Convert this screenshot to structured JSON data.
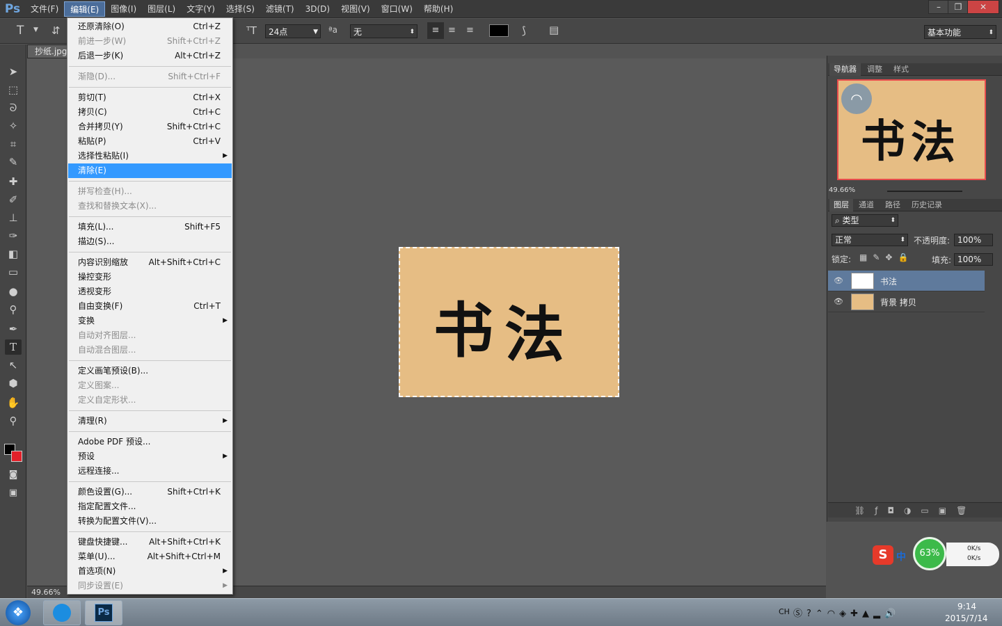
{
  "app": {
    "logo": "Ps",
    "menus": [
      "文件(F)",
      "编辑(E)",
      "图像(I)",
      "图层(L)",
      "文字(Y)",
      "选择(S)",
      "滤镜(T)",
      "3D(D)",
      "视图(V)",
      "窗口(W)",
      "帮助(H)"
    ],
    "active_menu": "编辑(E)",
    "window_controls": [
      "–",
      "❐",
      "✕"
    ]
  },
  "options": {
    "font_size": "24点",
    "antialias": "无",
    "workspace": "基本功能",
    "color_hex": "#000000"
  },
  "document": {
    "tab_title": "抄纸.jpg",
    "zoom": "49.66%",
    "text_glyph_1": "书",
    "text_glyph_2": "法"
  },
  "edit_menu": [
    {
      "label": "还原清除(O)",
      "shortcut": "Ctrl+Z",
      "disabled": false
    },
    {
      "label": "前进一步(W)",
      "shortcut": "Shift+Ctrl+Z",
      "disabled": true
    },
    {
      "label": "后退一步(K)",
      "shortcut": "Alt+Ctrl+Z",
      "disabled": false
    },
    {
      "sep": true
    },
    {
      "label": "渐隐(D)...",
      "shortcut": "Shift+Ctrl+F",
      "disabled": true
    },
    {
      "sep": true
    },
    {
      "label": "剪切(T)",
      "shortcut": "Ctrl+X",
      "disabled": false
    },
    {
      "label": "拷贝(C)",
      "shortcut": "Ctrl+C",
      "disabled": false
    },
    {
      "label": "合并拷贝(Y)",
      "shortcut": "Shift+Ctrl+C",
      "disabled": false
    },
    {
      "label": "粘贴(P)",
      "shortcut": "Ctrl+V",
      "disabled": false
    },
    {
      "label": "选择性粘贴(I)",
      "shortcut": "",
      "submenu": true,
      "disabled": false
    },
    {
      "label": "清除(E)",
      "shortcut": "",
      "highlight": true,
      "disabled": false
    },
    {
      "sep": true
    },
    {
      "label": "拼写检查(H)...",
      "shortcut": "",
      "disabled": true
    },
    {
      "label": "查找和替换文本(X)...",
      "shortcut": "",
      "disabled": true
    },
    {
      "sep": true
    },
    {
      "label": "填充(L)...",
      "shortcut": "Shift+F5",
      "disabled": false
    },
    {
      "label": "描边(S)...",
      "shortcut": "",
      "disabled": false
    },
    {
      "sep": true
    },
    {
      "label": "内容识别缩放",
      "shortcut": "Alt+Shift+Ctrl+C",
      "disabled": false
    },
    {
      "label": "操控变形",
      "shortcut": "",
      "disabled": false
    },
    {
      "label": "透视变形",
      "shortcut": "",
      "disabled": false
    },
    {
      "label": "自由变换(F)",
      "shortcut": "Ctrl+T",
      "disabled": false
    },
    {
      "label": "变换",
      "shortcut": "",
      "submenu": true,
      "disabled": false
    },
    {
      "label": "自动对齐图层...",
      "shortcut": "",
      "disabled": true
    },
    {
      "label": "自动混合图层...",
      "shortcut": "",
      "disabled": true
    },
    {
      "sep": true
    },
    {
      "label": "定义画笔预设(B)...",
      "shortcut": "",
      "disabled": false
    },
    {
      "label": "定义图案...",
      "shortcut": "",
      "disabled": true
    },
    {
      "label": "定义自定形状...",
      "shortcut": "",
      "disabled": true
    },
    {
      "sep": true
    },
    {
      "label": "清理(R)",
      "shortcut": "",
      "submenu": true,
      "disabled": false
    },
    {
      "sep": true
    },
    {
      "label": "Adobe PDF 预设...",
      "shortcut": "",
      "disabled": false
    },
    {
      "label": "预设",
      "shortcut": "",
      "submenu": true,
      "disabled": false
    },
    {
      "label": "远程连接...",
      "shortcut": "",
      "disabled": false
    },
    {
      "sep": true
    },
    {
      "label": "颜色设置(G)...",
      "shortcut": "Shift+Ctrl+K",
      "disabled": false
    },
    {
      "label": "指定配置文件...",
      "shortcut": "",
      "disabled": false
    },
    {
      "label": "转换为配置文件(V)...",
      "shortcut": "",
      "disabled": false
    },
    {
      "sep": true
    },
    {
      "label": "键盘快捷键...",
      "shortcut": "Alt+Shift+Ctrl+K",
      "disabled": false
    },
    {
      "label": "菜单(U)...",
      "shortcut": "Alt+Shift+Ctrl+M",
      "disabled": false
    },
    {
      "label": "首选项(N)",
      "shortcut": "",
      "submenu": true,
      "disabled": false
    },
    {
      "label": "同步设置(E)",
      "shortcut": "",
      "submenu": true,
      "disabled": true
    }
  ],
  "navigator": {
    "tabs": [
      "导航器",
      "调整",
      "样式"
    ],
    "zoom": "49.66%"
  },
  "layers_panel": {
    "tabs": [
      "图层",
      "通道",
      "路径",
      "历史记录"
    ],
    "filter_label": "类型",
    "blend_mode": "正常",
    "opacity_label": "不透明度:",
    "opacity": "100%",
    "lock_label": "锁定:",
    "fill_label": "填充:",
    "fill": "100%",
    "layers": [
      {
        "name": "书法",
        "selected": true
      },
      {
        "name": "背景 拷贝",
        "selected": false
      }
    ]
  },
  "float_widget": {
    "percent": "63%",
    "up": "0K/s",
    "down": "0K/s",
    "ime": "中"
  },
  "taskbar": {
    "lang": "CH",
    "time": "9:14",
    "date": "2015/7/14"
  }
}
